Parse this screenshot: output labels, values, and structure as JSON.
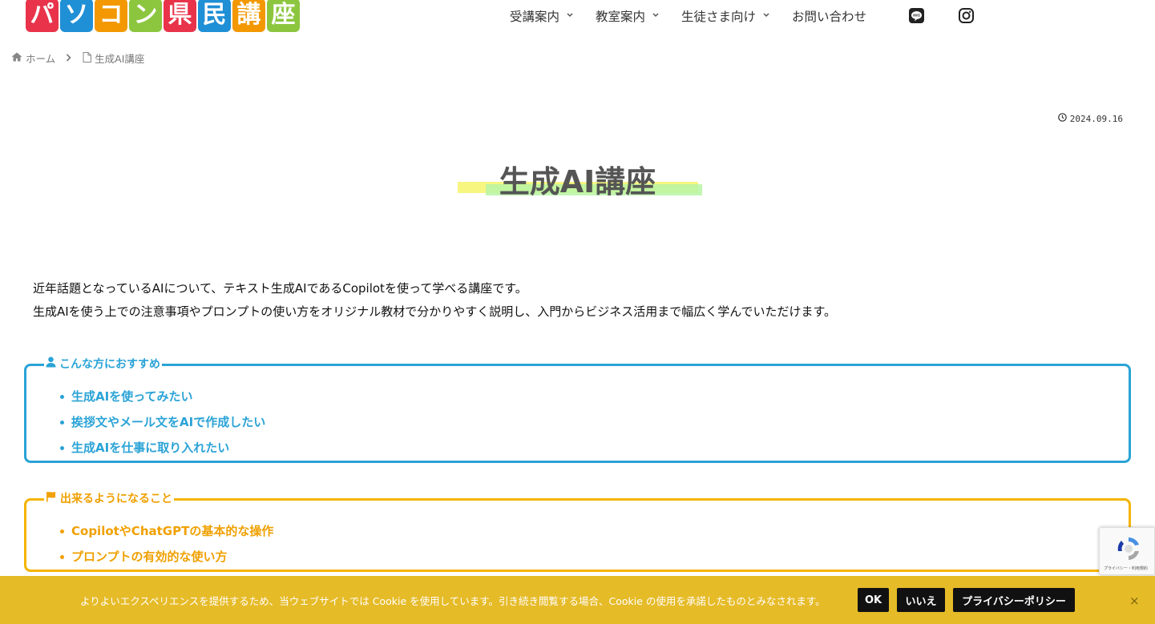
{
  "header": {
    "logo_chars": [
      {
        "ch": "パ",
        "color": "#e8334a"
      },
      {
        "ch": "ソ",
        "color": "#1f8fd6"
      },
      {
        "ch": "コ",
        "color": "#f39800"
      },
      {
        "ch": "ン",
        "color": "#8cc63f"
      },
      {
        "ch": "県",
        "color": "#e8334a"
      },
      {
        "ch": "民",
        "color": "#1f8fd6"
      },
      {
        "ch": "講",
        "color": "#f39800"
      },
      {
        "ch": "座",
        "color": "#8cc63f"
      }
    ],
    "nav": [
      {
        "label": "受講案内",
        "has_dropdown": true
      },
      {
        "label": "教室案内",
        "has_dropdown": true
      },
      {
        "label": "生徒さま向け",
        "has_dropdown": true
      },
      {
        "label": "お問い合わせ",
        "has_dropdown": false
      }
    ],
    "social": [
      "line-icon",
      "instagram-icon"
    ]
  },
  "breadcrumb": {
    "home": "ホーム",
    "current": "生成AI講座"
  },
  "post": {
    "date": "2024.09.16",
    "title": "生成AI講座",
    "intro": [
      "近年話題となっているAIについて、テキスト生成AIであるCopilotを使って学べる講座です。",
      "生成AIを使う上での注意事項やプロンプトの使い方をオリジナル教材で分かりやすく説明し、入門からビジネス活用まで幅広く学んでいただけます。"
    ]
  },
  "recommend_box": {
    "heading": "こんな方におすすめ",
    "items": [
      "生成AIを使ってみたい",
      "挨拶文やメール文をAIで作成したい",
      "生成AIを仕事に取り入れたい"
    ]
  },
  "goals_box": {
    "heading": "出来るようになること",
    "items": [
      "CopilotやChatGPTの基本的な操作",
      "プロンプトの有効的な使い方"
    ]
  },
  "cookie_bar": {
    "message": "よりよいエクスペリエンスを提供するため、当ウェブサイトでは Cookie を使用しています。引き続き閲覧する場合、Cookie の使用を承諾したものとみなされます。",
    "ok": "OK",
    "no": "いいえ",
    "policy": "プライバシーポリシー",
    "close": "×"
  },
  "recaptcha": {
    "text": "プライバシー・利用規約"
  },
  "colors": {
    "blue": "#2aa3d6",
    "orange": "#f0a000",
    "cookie_bg": "#e6bb28"
  }
}
